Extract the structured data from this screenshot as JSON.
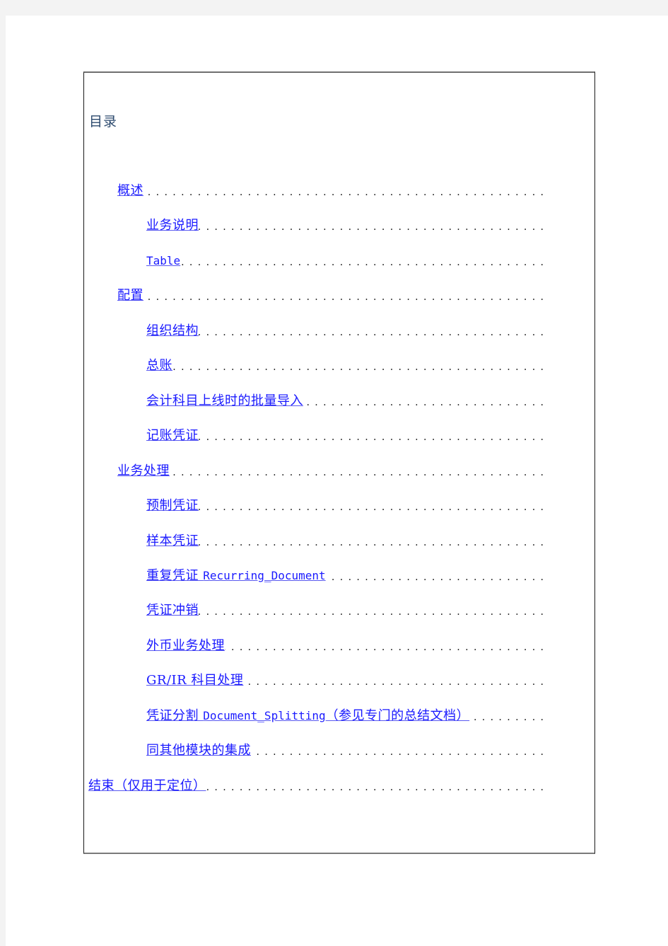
{
  "document": {
    "toc_title": "目录",
    "entries": [
      {
        "level": 1,
        "text": "概述",
        "mono": ""
      },
      {
        "level": 2,
        "text": "业务说明",
        "mono": ""
      },
      {
        "level": 2,
        "text": "",
        "mono": "Table"
      },
      {
        "level": 1,
        "text": "配置",
        "mono": ""
      },
      {
        "level": 2,
        "text": "组织结构",
        "mono": ""
      },
      {
        "level": 2,
        "text": "总账",
        "mono": ""
      },
      {
        "level": 2,
        "text": "会计科目上线时的批量导入",
        "mono": ""
      },
      {
        "level": 2,
        "text": "记账凭证",
        "mono": ""
      },
      {
        "level": 1,
        "text": "业务处理",
        "mono": ""
      },
      {
        "level": 2,
        "text": "预制凭证",
        "mono": ""
      },
      {
        "level": 2,
        "text": "样本凭证",
        "mono": ""
      },
      {
        "level": 2,
        "text": "重复凭证 ",
        "mono": "Recurring_Document"
      },
      {
        "level": 2,
        "text": "凭证冲销",
        "mono": ""
      },
      {
        "level": 2,
        "text": "外币业务处理",
        "mono": ""
      },
      {
        "level": 2,
        "text": "GR/IR 科目处理",
        "mono": ""
      },
      {
        "level": 2,
        "text": "凭证分割 ",
        "mono": "Document_Splitting",
        "suffix": "（参见专门的总结文档） "
      },
      {
        "level": 2,
        "text": "同其他模块的集成",
        "mono": ""
      },
      {
        "level": 0,
        "text": "结束（仅用于定位） ",
        "mono": ""
      }
    ],
    "dot_leader": "........................................................................",
    "colors": {
      "link": "#1a1aff",
      "title": "#2c4a6e",
      "dots": "#222222"
    }
  }
}
